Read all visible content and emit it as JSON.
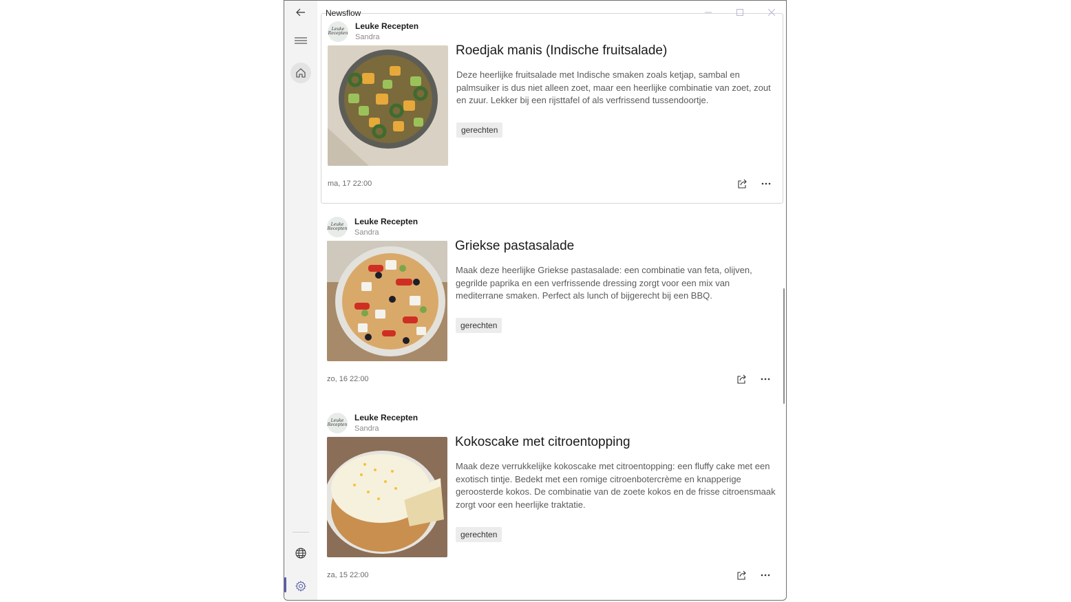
{
  "app": {
    "title": "Newsflow"
  },
  "sidebar": {
    "back_icon": "back-arrow-icon",
    "menu_icon": "hamburger-icon",
    "home_icon": "home-icon",
    "web_icon": "globe-icon",
    "settings_icon": "gear-icon"
  },
  "colors": {
    "accent": "#5a5fa8",
    "tag_bg": "#ececec"
  },
  "articles": [
    {
      "source": "Leuke Recepten",
      "avatar_text": "Leuke Recepten",
      "author": "Sandra",
      "title": "Roedjak manis (Indische fruitsalade)",
      "description": "Deze heerlijke fruitsalade met Indische smaken zoals ketjap, sambal en palmsuiker is dus niet alleen zoet, maar een heerlijke combinatie van zoet, zout en zuur. Lekker bij een rijsttafel of als verfrissend tussendoortje.",
      "tag": "gerechten",
      "date": "ma, 17 22:00"
    },
    {
      "source": "Leuke Recepten",
      "avatar_text": "Leuke Recepten",
      "author": "Sandra",
      "title": "Griekse pastasalade",
      "description": "Maak deze heerlijke Griekse pastasalade: een combinatie van feta, olijven, gegrilde paprika en een verfrissende dressing zorgt voor een mix van mediterrane smaken. Perfect als lunch of bijgerecht bij een BBQ.",
      "tag": "gerechten",
      "date": "zo, 16 22:00"
    },
    {
      "source": "Leuke Recepten",
      "avatar_text": "Leuke Recepten",
      "author": "Sandra",
      "title": "Kokoscake met citroentopping",
      "description": "Maak deze verrukkelijke kokoscake met citroentopping: een fluffy cake met een exotisch tintje. Bedekt met een romige citroenbotercrème en knapperige geroosterde kokos. De combinatie van de zoete kokos en de frisse citroensmaak zorgt voor een heerlijke traktatie.",
      "tag": "gerechten",
      "date": "za, 15 22:00"
    }
  ]
}
